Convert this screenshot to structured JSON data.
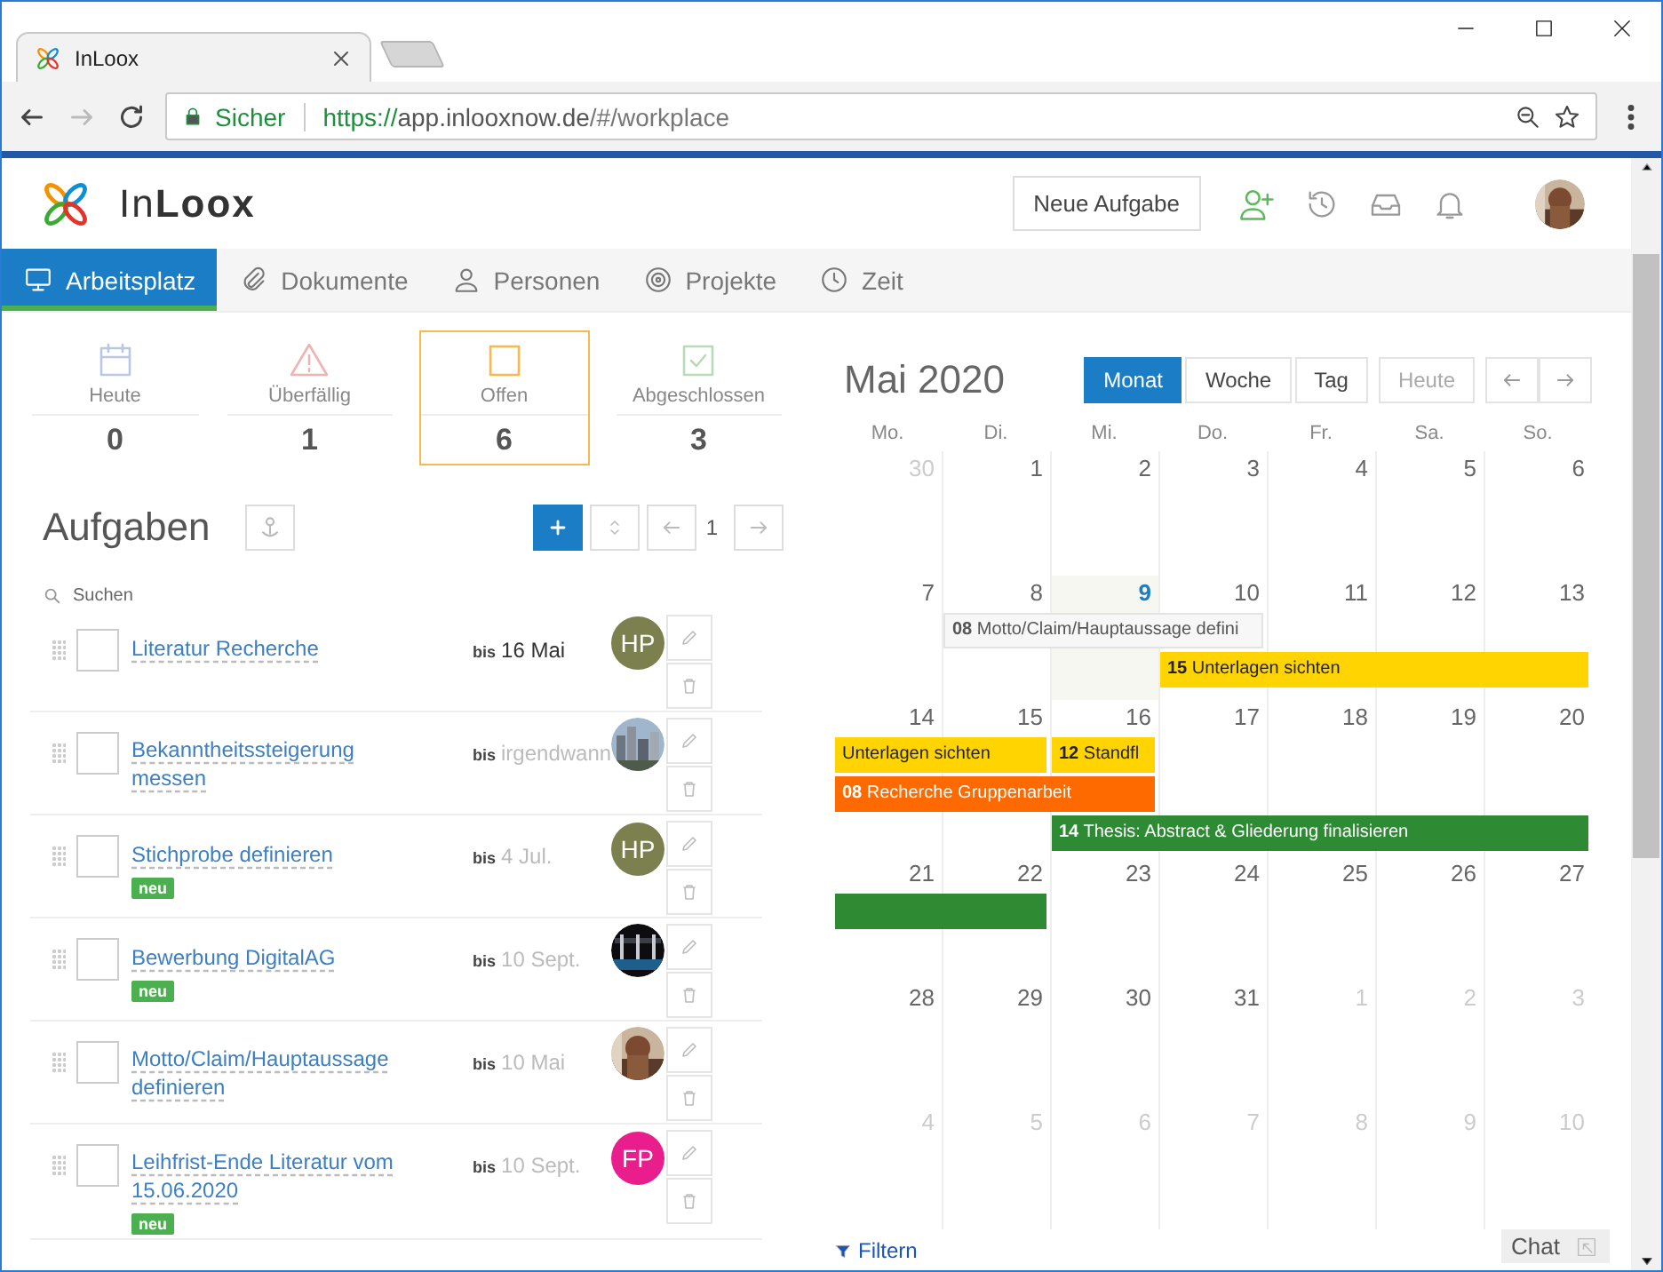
{
  "browser": {
    "tab_title": "InLoox",
    "security": "Sicher",
    "url_scheme": "https://",
    "url_host": "app.inlooxnow.de",
    "url_path": "/#/workplace"
  },
  "header": {
    "logo": "In**Loox**",
    "new_task_button": "Neue Aufgabe"
  },
  "nav": [
    {
      "kind": "monitor",
      "label": "Arbeitsplatz",
      "selected": true
    },
    {
      "kind": "paperclip",
      "label": "Dokumente",
      "selected": false
    },
    {
      "kind": "person",
      "label": "Personen",
      "selected": false
    },
    {
      "kind": "target",
      "label": "Projekte",
      "selected": false
    },
    {
      "kind": "clock",
      "label": "Zeit",
      "selected": false
    }
  ],
  "stats": [
    {
      "kind": "today",
      "label": "Heute",
      "count": "0",
      "selected": false
    },
    {
      "kind": "overdue",
      "label": "Überfällig",
      "count": "1",
      "selected": false
    },
    {
      "kind": "open",
      "label": "Offen",
      "count": "6",
      "selected": true
    },
    {
      "kind": "done",
      "label": "Abgeschlossen",
      "count": "3",
      "selected": false
    }
  ],
  "tasks": {
    "title": "Aufgaben",
    "page": "1",
    "search": {
      "placeholder": "Suchen"
    },
    "items": [
      {
        "checked": false,
        "title": "Literatur Recherche",
        "due_prefix": "bis",
        "due": "16 Mai",
        "due_highlight": true,
        "assignee": {
          "kind": "initials",
          "initials": "HP",
          "color": "#7c7f4e"
        }
      },
      {
        "checked": false,
        "title": "Bekanntheitssteigerung messen",
        "due_prefix": "bis",
        "due": "irgendwann",
        "due_highlight": false
      },
      {
        "checked": false,
        "title": "Stichprobe definieren",
        "badge": "neu",
        "due_prefix": "bis",
        "due": "4 Jul.",
        "due_highlight": false,
        "assignee": {
          "kind": "initials",
          "initials": "HP",
          "color": "#7c7f4e"
        }
      },
      {
        "checked": false,
        "title": "Bewerbung DigitalAG",
        "badge": "neu",
        "due_prefix": "bis",
        "due": "10 Sept.",
        "due_highlight": false
      },
      {
        "checked": false,
        "title": "Motto/Claim/Hauptaussage definieren",
        "due_prefix": "bis",
        "due": "10 Mai",
        "due_highlight": false
      },
      {
        "checked": false,
        "title": "Leihfrist-Ende Literatur vom 15.06.2020",
        "badge": "neu",
        "due_prefix": "bis",
        "due": "10 Sept.",
        "due_highlight": false,
        "assignee": {
          "kind": "initials",
          "initials": "FP",
          "color": "#e91e8c"
        }
      }
    ]
  },
  "calendar": {
    "title": "Mai 2020",
    "views": [
      {
        "label": "Monat",
        "selected": true
      },
      {
        "label": "Woche",
        "selected": false
      },
      {
        "label": "Tag",
        "selected": false
      }
    ],
    "today_button": {
      "label": "Heute",
      "disabled": true
    },
    "weekdays": [
      "Mo.",
      "Di.",
      "Mi.",
      "Do.",
      "Fr.",
      "Sa.",
      "So."
    ],
    "weeks": [
      {
        "days": [
          {
            "day": "30",
            "muted": true,
            "today": false
          },
          {
            "day": "1",
            "muted": false,
            "today": false
          },
          {
            "day": "2",
            "muted": false,
            "today": false
          },
          {
            "day": "3",
            "muted": false,
            "today": false
          },
          {
            "day": "4",
            "muted": false,
            "today": false
          },
          {
            "day": "5",
            "muted": false,
            "today": false
          },
          {
            "day": "6",
            "muted": false,
            "today": false
          }
        ]
      },
      {
        "days": [
          {
            "day": "7",
            "muted": false,
            "today": false
          },
          {
            "day": "8",
            "muted": false,
            "today": false,
            "events": [
              {
                "kind": "start",
                "text": "**08** Motto/Claim/Hauptaussage defini",
                "color": "#f7f7f7"
              }
            ]
          },
          {
            "day": "9",
            "muted": false,
            "today": true,
            "events": [
              {
                "kind": "continuation"
              }
            ]
          },
          {
            "day": "10",
            "muted": false,
            "today": false,
            "events": [
              {
                "kind": "continuation"
              },
              {
                "kind": "start",
                "text": "**15** Unterlagen sichten",
                "color": "#ffd400"
              }
            ]
          },
          {
            "day": "11",
            "muted": false,
            "today": false,
            "events": [
              {
                "kind": "empty"
              },
              {
                "kind": "continuation"
              }
            ]
          },
          {
            "day": "12",
            "muted": false,
            "today": false,
            "events": [
              {
                "kind": "empty"
              },
              {
                "kind": "continuation"
              }
            ]
          },
          {
            "day": "13",
            "muted": false,
            "today": false,
            "events": [
              {
                "kind": "empty"
              },
              {
                "kind": "continuation"
              }
            ]
          }
        ]
      },
      {
        "days": [
          {
            "day": "14",
            "muted": false,
            "today": false,
            "events": [
              {
                "kind": "start",
                "text": "Unterlagen sichten",
                "color": "#ffd400"
              },
              {
                "kind": "start",
                "text": "**08** Recherche Gruppenarbeit",
                "color": "#ff6a00"
              }
            ]
          },
          {
            "day": "15",
            "muted": false,
            "today": false,
            "events": [
              {
                "kind": "continuation"
              },
              {
                "kind": "continuation"
              }
            ]
          },
          {
            "day": "16",
            "muted": false,
            "today": false,
            "events": [
              {
                "kind": "start",
                "text": "**12** Standfl",
                "color": "#ffd400"
              },
              {
                "kind": "continuation"
              },
              {
                "kind": "start",
                "text": "**14** Thesis: Abstract & Gliederung finalisieren",
                "color": "#2e8b34"
              }
            ]
          },
          {
            "day": "17",
            "muted": false,
            "today": false,
            "events": [
              {
                "kind": "empty"
              },
              {
                "kind": "empty"
              },
              {
                "kind": "continuation"
              }
            ]
          },
          {
            "day": "18",
            "muted": false,
            "today": false,
            "events": [
              {
                "kind": "empty"
              },
              {
                "kind": "empty"
              },
              {
                "kind": "continuation"
              }
            ]
          },
          {
            "day": "19",
            "muted": false,
            "today": false,
            "events": [
              {
                "kind": "empty"
              },
              {
                "kind": "empty"
              },
              {
                "kind": "continuation"
              }
            ]
          },
          {
            "day": "20",
            "muted": false,
            "today": false,
            "events": [
              {
                "kind": "empty"
              },
              {
                "kind": "empty"
              },
              {
                "kind": "continuation"
              }
            ]
          }
        ]
      },
      {
        "days": [
          {
            "day": "21",
            "muted": false,
            "today": false,
            "events": [
              {
                "kind": "start",
                "color": "#2e8b34"
              }
            ]
          },
          {
            "day": "22",
            "muted": false,
            "today": false,
            "events": [
              {
                "kind": "continuation"
              }
            ]
          },
          {
            "day": "23",
            "muted": false,
            "today": false
          },
          {
            "day": "24",
            "muted": false,
            "today": false
          },
          {
            "day": "25",
            "muted": false,
            "today": false
          },
          {
            "day": "26",
            "muted": false,
            "today": false
          },
          {
            "day": "27",
            "muted": false,
            "today": false
          }
        ]
      },
      {
        "days": [
          {
            "day": "28",
            "muted": false,
            "today": false
          },
          {
            "day": "29",
            "muted": false,
            "today": false
          },
          {
            "day": "30",
            "muted": false,
            "today": false
          },
          {
            "day": "31",
            "muted": false,
            "today": false
          },
          {
            "day": "1",
            "muted": true,
            "today": false
          },
          {
            "day": "2",
            "muted": true,
            "today": false
          },
          {
            "day": "3",
            "muted": true,
            "today": false
          }
        ]
      },
      {
        "days": [
          {
            "day": "4",
            "muted": true,
            "today": false
          },
          {
            "day": "5",
            "muted": true,
            "today": false
          },
          {
            "day": "6",
            "muted": true,
            "today": false
          },
          {
            "day": "7",
            "muted": true,
            "today": false
          },
          {
            "day": "8",
            "muted": true,
            "today": false
          },
          {
            "day": "9",
            "muted": true,
            "today": false
          },
          {
            "day": "10",
            "muted": true,
            "today": false
          }
        ]
      }
    ]
  },
  "footer": {
    "filter_link": "Filtern",
    "chat_button": "Chat"
  }
}
